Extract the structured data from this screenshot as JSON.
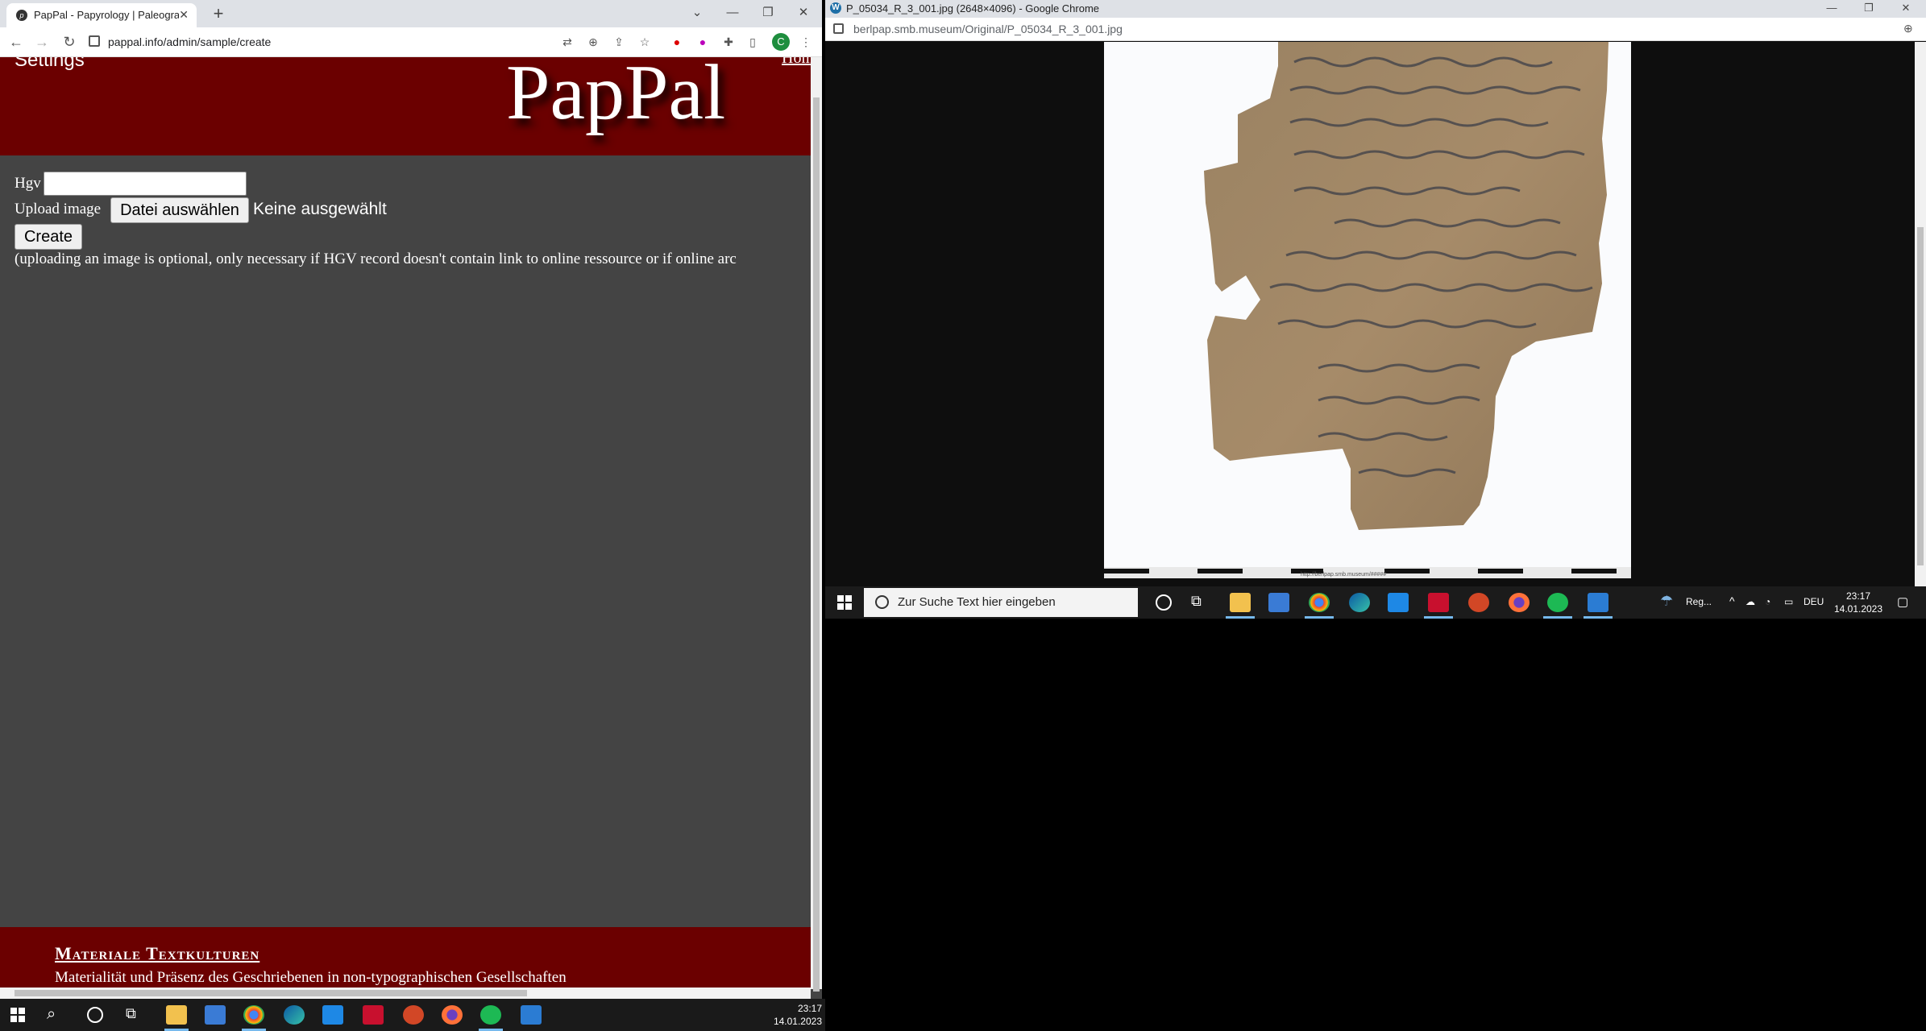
{
  "left_browser": {
    "tab_title": "PapPal - Papyrology | Paleograph",
    "url": "pappal.info/admin/sample/create",
    "profile_initial": "C"
  },
  "page": {
    "settings_label": "Settings",
    "logo_text": "PapPal",
    "home_link": "Hom",
    "hgv_label": "Hgv",
    "hgv_value": "",
    "upload_label": "Upload image",
    "file_button_label": "Datei auswählen",
    "file_status": "Keine ausgewählt",
    "create_button_label": "Create",
    "hint_text": "(uploading an image is optional, only necessary if HGV record doesn't contain link to online ressource or if online arc",
    "footer_title": "Materiale Textkulturen",
    "footer_subtitle": "Materialität und Präsenz des Geschriebenen in non-typographischen Gesellschaften"
  },
  "left_taskbar": {
    "time": "23:17",
    "date": "14.01.2023"
  },
  "right_browser": {
    "window_title": "P_05034_R_3_001.jpg (2648×4096) - Google Chrome",
    "url": "berlpap.smb.museum/Original/P_05034_R_3_001.jpg",
    "ruler_caption": "http://berlpap.smb.museum/#####"
  },
  "right_taskbar": {
    "search_placeholder": "Zur Suche Text hier eingeben",
    "weather_label": "Reg...",
    "language": "DEU",
    "time": "23:17",
    "date": "14.01.2023"
  },
  "colors": {
    "banner": "#6b0000",
    "page_bg": "#444444",
    "taskbar": "#1a1a1a"
  }
}
